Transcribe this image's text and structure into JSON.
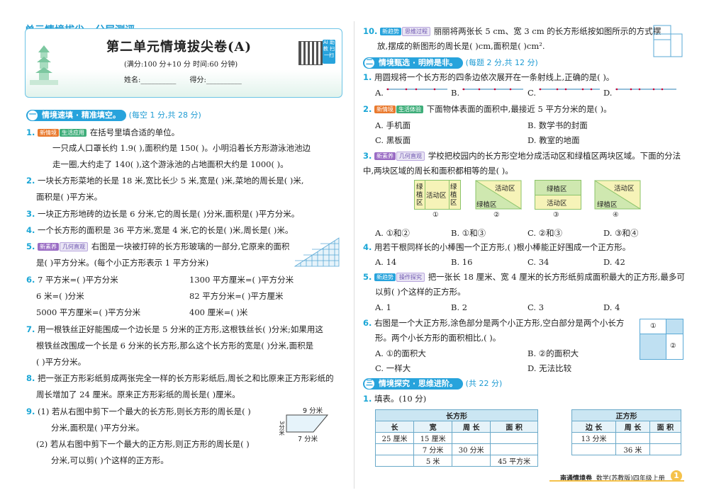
{
  "header": {
    "series": "单元情境拔尖 · 分层测评",
    "title": "第二单元情境拔尖卷(A)",
    "meta": "(满分:100 分+10 分    时间:60 分钟)",
    "name_label": "姓名:__________",
    "score_label": "得分:__________",
    "ai_badge": "AI 助教 扫一扫"
  },
  "sections": {
    "s1": {
      "num": "一",
      "title": "情境速填 · 精准填空。",
      "note": "(每空 1 分,共 28 分)"
    },
    "s2": {
      "num": "二",
      "title": "情境甄选 · 明辨是非。",
      "note": "(每题 2 分,共 12 分)"
    },
    "s3": {
      "num": "三",
      "title": "情境探究 · 思维进阶。",
      "note": "(共 22 分)"
    }
  },
  "tags": {
    "t1a": "新情境",
    "t1b": "生活应用",
    "t5a": "新素养",
    "t5b": "几何直观",
    "t10a": "新趋势",
    "t10b": "思维过程",
    "t22a": "新情境",
    "t22b": "生活体验",
    "t23a": "新素养",
    "t23b": "几何直观",
    "t25a": "新趋势",
    "t25b": "操作探究"
  },
  "left": {
    "q1n": "1.",
    "q1l1": "在括号里填合适的单位。",
    "q1l2": "一只成人口罩长约 1.9(    ),面积约是 150(    )。小明沿着长方形游泳池池边",
    "q1l3": "走一圈,大约走了 140(    ),这个游泳池的占地面积大约是 1000(    )。",
    "q2n": "2.",
    "q2l1": "一块长方形菜地的长是 18 米,宽比长少 5 米,宽是(      )米,菜地的周长是(      )米,",
    "q2l2": "面积是(      )平方米。",
    "q3n": "3.",
    "q3l1": "一块正方形地砖的边长是 6 分米,它的周长是(      )分米,面积是(      )平方分米。",
    "q4n": "4.",
    "q4l1": "一个长方形的面积是 36 平方米,宽是 4 米,它的长是(      )米,周长是(      )米。",
    "q5n": "5.",
    "q5l1": "右图是一块被打碎的长方形玻璃的一部分,它原来的面积",
    "q5l2": "是(      )平方分米。(每个小正方形表示 1 平方分米)",
    "q6n": "6.",
    "q6a": "7 平方米=(      )平方分米",
    "q6b": "1300 平方厘米=(      )平方分米",
    "q6c": "6 米=(      )分米",
    "q6d": "82 平方分米=(      )平方厘米",
    "q6e": "5000 平方厘米=(      )平方分米",
    "q6f": "400 厘米=(      )米",
    "q7n": "7.",
    "q7l1": "用一根铁丝正好能围成一个边长是 5 分米的正方形,这根铁丝长(      )分米;如果用这",
    "q7l2": "根铁丝改围成一个长是 6 分米的长方形,那么这个长方形的宽是(      )分米,面积是",
    "q7l3": "(      )平方分米。",
    "q8n": "8.",
    "q8l1": "把一张正方形彩纸剪成两张完全一样的长方形彩纸后,周长之和比原来正方形彩纸的",
    "q8l2": "周长增加了 24 厘米。原来正方形彩纸的周长是(      )厘米。",
    "q9n": "9.",
    "q9l1": "(1) 若从右图中剪下一个最大的长方形,则长方形的周长是(      )",
    "q9l2": "分米,面积是(      )平方分米。",
    "q9l3": "(2) 若从右图中剪下一个最大的正方形,则正方形的周长是(      )",
    "q9l4": "分米,可以剪(      )个这样的正方形。",
    "fig9": {
      "top": "9 分米",
      "left": "3分米",
      "bottom": "7 分米"
    }
  },
  "right": {
    "q10n": "10.",
    "q10l1": "丽丽将两张长 5 cm、宽 3 cm 的长方形纸按如图所示的方式摆",
    "q10l2": "放,摆成的新图形的周长是(      )cm,面积是(      )cm².",
    "q21n": "1.",
    "q21l1": "用圆规将一个长方形的四条边依次展开在一条射线上,正确的是(      )。",
    "q21opts": [
      "A.",
      "B.",
      "C.",
      "D."
    ],
    "q22n": "2.",
    "q22l1": "下面物体表面的面积中,最接近 5 平方分米的是(      )。",
    "q22opts": [
      "A. 手机面",
      "B. 数学书的封面",
      "C. 黑板面",
      "D. 教室的地面"
    ],
    "q23n": "3.",
    "q23l1": "学校把校园内的长方形空地分成活动区和绿植区两块区域。下面的分法",
    "q23l2": "中,两块区域的周长和面积都相等的是(      )。",
    "q23fig": {
      "green": "绿植区",
      "act": "活动区",
      "nums": [
        "①",
        "②",
        "③",
        "④"
      ]
    },
    "q23opts": [
      "A. ①和②",
      "B. ①和③",
      "C. ②和③",
      "D. ③和④"
    ],
    "q24n": "4.",
    "q24l1": "用若干根同样长的小棒围一个正方形,(      )根小棒能正好围成一个正方形。",
    "q24opts": [
      "A. 14",
      "B. 16",
      "C. 34",
      "D. 42"
    ],
    "q25n": "5.",
    "q25l1": "把一张长 18 厘米、宽 4 厘米的长方形纸剪成面积最大的正方形,最多可",
    "q25l2": "以剪(      )个这样的正方形。",
    "q25opts": [
      "A. 1",
      "B. 2",
      "C. 3",
      "D. 4"
    ],
    "q26n": "6.",
    "q26l1": "右图是一个大正方形,涂色部分是两个小正方形,空白部分是两个小长方",
    "q26l2": "形。两个小长方形的面积相比,(      )。",
    "q26opts": [
      "A. ①的面积大",
      "B. ②的面积大",
      "C. 一样大",
      "D. 无法比较"
    ],
    "q26fig": {
      "a": "①",
      "b": "②"
    },
    "q31n": "1.",
    "q31l1": "填表。(10 分)",
    "rect_table": {
      "title": "长方形",
      "headers": [
        "长",
        "宽",
        "周 长",
        "面 积"
      ],
      "rows": [
        [
          "25 厘米",
          "15 厘米",
          "",
          ""
        ],
        [
          "",
          "7 分米",
          "30 分米",
          ""
        ],
        [
          "",
          "5 米",
          "",
          "45 平方米"
        ]
      ]
    },
    "sq_table": {
      "title": "正方形",
      "headers": [
        "边 长",
        "周 长",
        "面 积"
      ],
      "rows": [
        [
          "13 分米",
          "",
          ""
        ],
        [
          "",
          "36 米",
          ""
        ]
      ]
    }
  },
  "footer": {
    "brand": "南通情境卷",
    "book": "数学(苏教版)四年级上册",
    "page": "1"
  }
}
